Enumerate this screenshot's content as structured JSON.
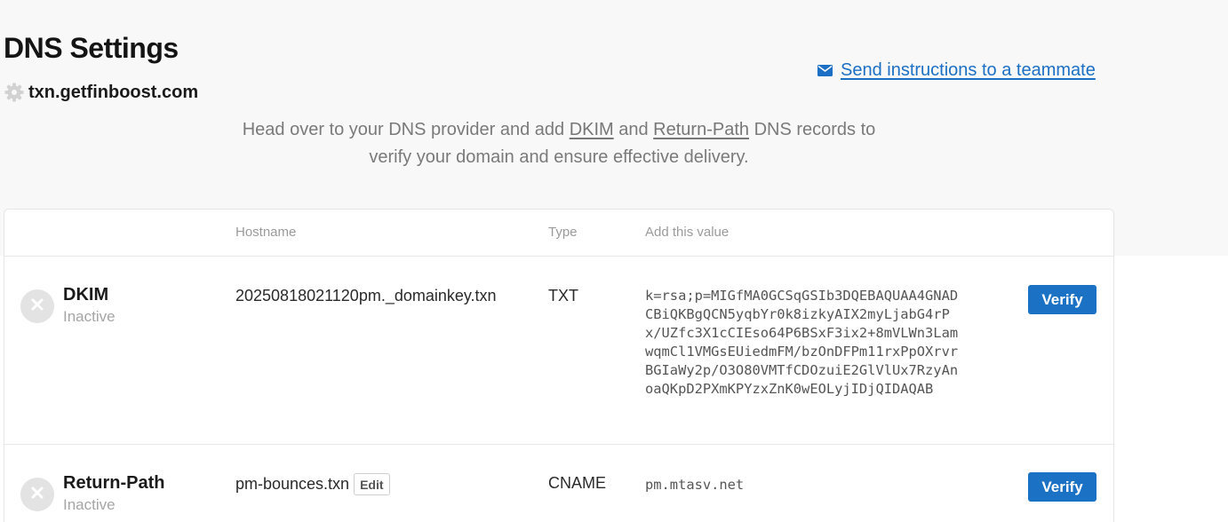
{
  "header": {
    "title": "DNS Settings",
    "domain": "txn.getfinboost.com",
    "send_link": "Send instructions to a teammate"
  },
  "intro": {
    "part1": "Head over to your DNS provider and add ",
    "dkim": "DKIM",
    "and": " and ",
    "return_path": "Return-Path",
    "part2": " DNS records to",
    "line2": "verify your domain and ensure effective delivery."
  },
  "table": {
    "columns": {
      "hostname": "Hostname",
      "type": "Type",
      "value": "Add this value"
    },
    "rows": [
      {
        "name": "DKIM",
        "status": "Inactive",
        "hostname": "20250818021120pm._domainkey.txn",
        "type": "TXT",
        "value_lines": [
          "k=rsa;p=MIGfMA0GCSqGSIb3DQEBAQUAA4GNAD",
          "CBiQKBgQCN5yqbYr0k8izkyAIX2myLjabG4rP",
          "x/UZfc3X1cCIEso64P6BSxF3ix2+8mVLWn3Lam",
          "wqmCl1VMGsEUiedmFM/bzOnDFPm11rxPpOXrvr",
          "BGIaWy2p/O3O80VMTfCDOzuiE2GlVlUx7RzyAn",
          "oaQKpD2PXmKPYzxZnK0wEOLyjIDjQIDAQAB"
        ],
        "verify_label": "Verify"
      },
      {
        "name": "Return-Path",
        "status": "Inactive",
        "hostname": "pm-bounces.txn",
        "edit_label": "Edit",
        "type": "CNAME",
        "value": "pm.mtasv.net",
        "verify_label": "Verify"
      }
    ]
  },
  "colors": {
    "accent": "#1b72c4",
    "link": "#1b6fc4",
    "muted": "#a5a5a5"
  },
  "icons": [
    "gear-icon",
    "envelope-icon",
    "close-icon"
  ]
}
